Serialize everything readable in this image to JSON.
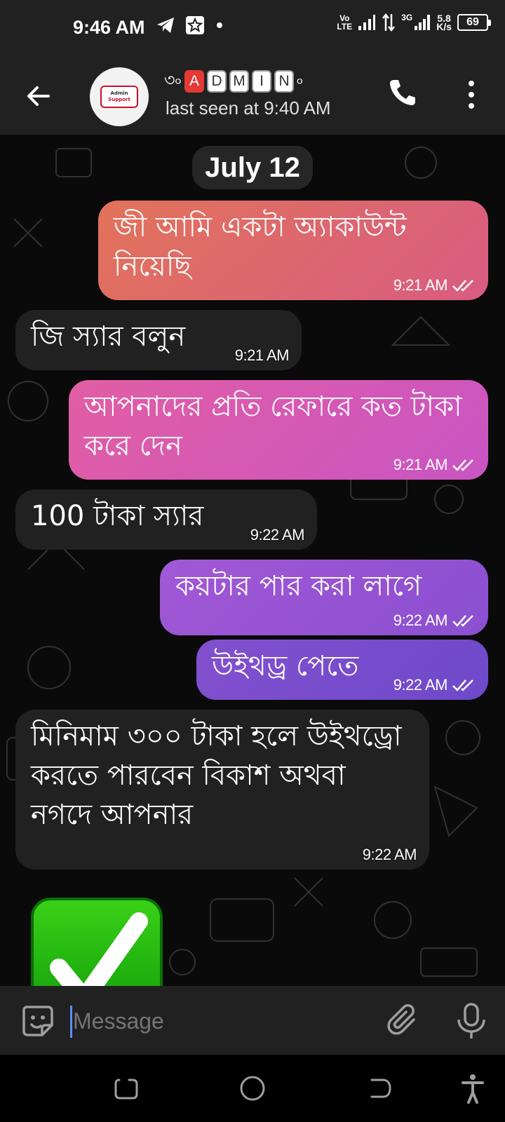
{
  "status_bar": {
    "time": "9:46 AM",
    "network_vo": "Vo",
    "network_lte": "LTE",
    "network_3g": "3G",
    "speed_value": "5.8",
    "speed_unit": "K/s",
    "battery": "69"
  },
  "header": {
    "contact_name_letters": [
      "A",
      "D",
      "M",
      "I",
      "N"
    ],
    "contact_prefix": "৩৹",
    "contact_suffix": "৹",
    "avatar_line1": "Admin",
    "avatar_line2": "Support",
    "last_seen": "last seen at 9:40 AM"
  },
  "chat": {
    "date_chip": "July 12",
    "messages": [
      {
        "direction": "out",
        "text": "জী আমি একটা অ্যাকাউন্ট নিয়েছি",
        "time": "9:21 AM"
      },
      {
        "direction": "in",
        "text": "জি স্যার বলুন",
        "time": "9:21 AM"
      },
      {
        "direction": "out",
        "text": "আপনাদের প্রতি রেফারে কত টাকা করে দেন",
        "time": "9:21 AM"
      },
      {
        "direction": "in",
        "text": "100 টাকা স্যার",
        "time": "9:22 AM"
      },
      {
        "direction": "out",
        "text": "কয়টার পার করা লাগে",
        "time": "9:22 AM"
      },
      {
        "direction": "out",
        "text": "উইথড্র পেতে",
        "time": "9:22 AM"
      },
      {
        "direction": "in",
        "text": "মিনিমাম ৩০০ টাকা হলে উইথড্রো করতে পারবেন বিকাশ অথবা নগদে আপনার",
        "time": "9:22 AM"
      }
    ]
  },
  "input": {
    "placeholder": "Message"
  },
  "colors": {
    "bar_bg": "#212121",
    "incoming_bubble": "#212121",
    "read_ticks": "#ffffff",
    "cursor": "#5c8df6"
  }
}
